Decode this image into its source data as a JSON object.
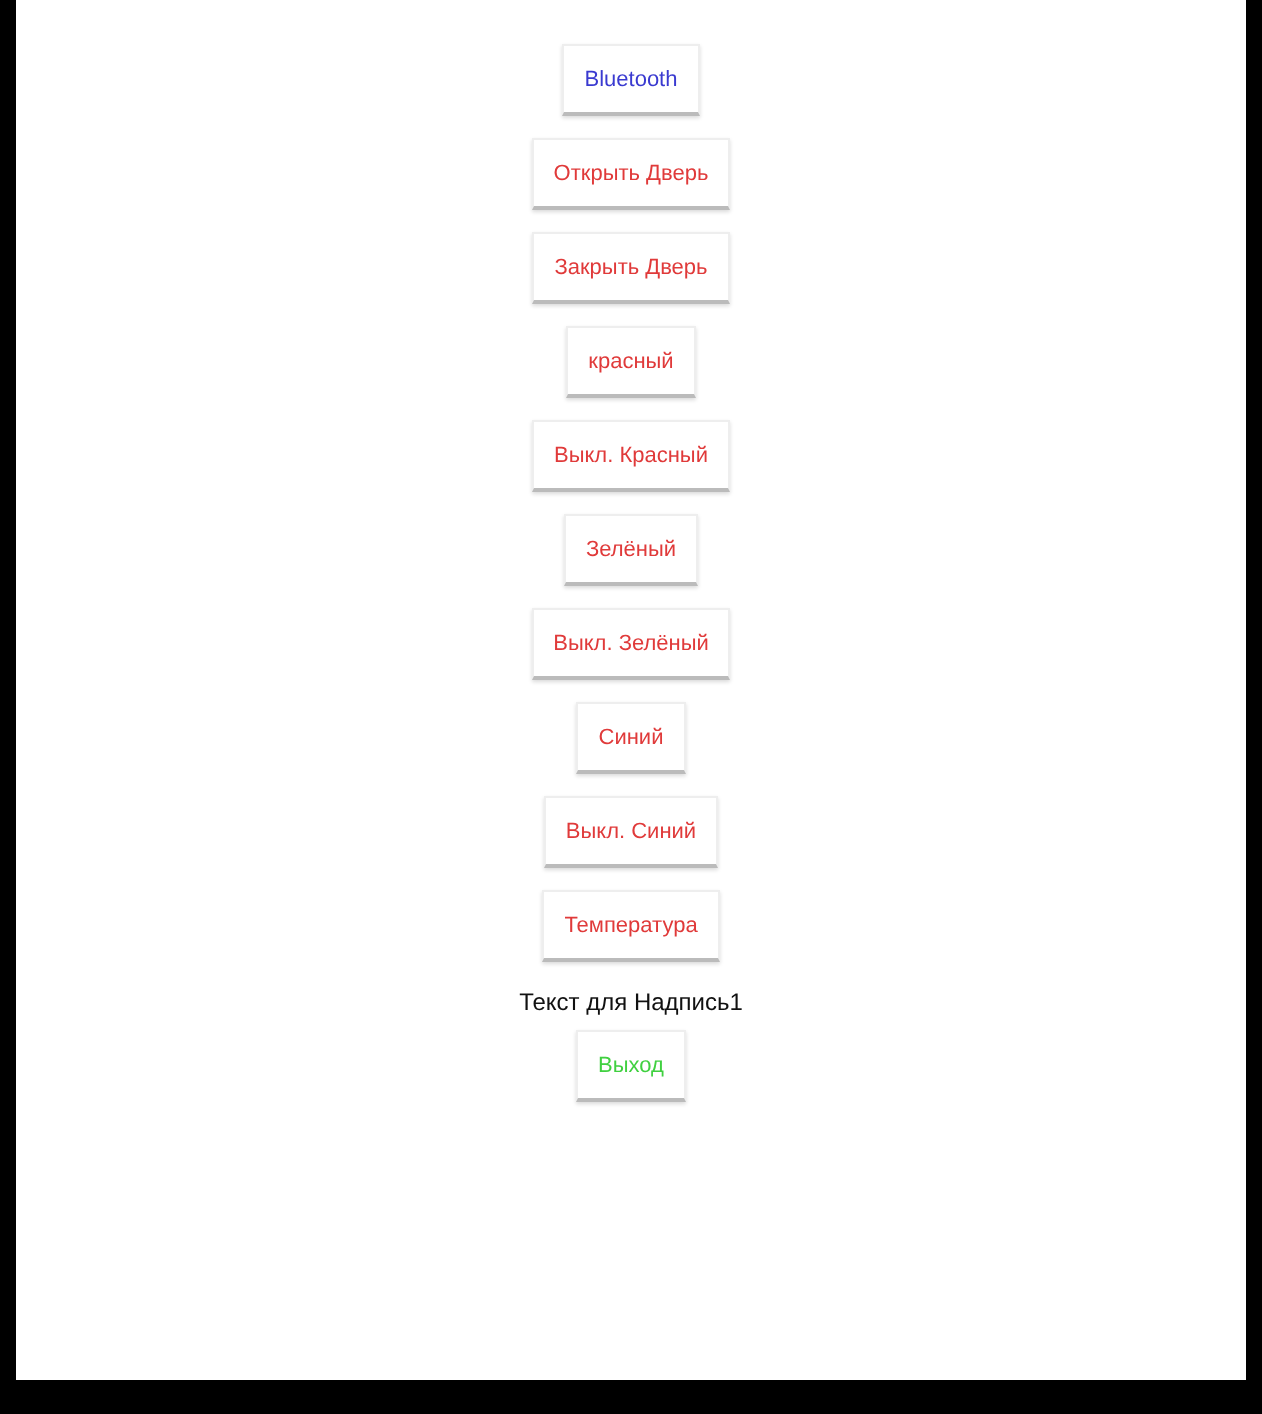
{
  "items": [
    {
      "kind": "button",
      "label": "Bluetooth",
      "color": "#3a3ad0"
    },
    {
      "kind": "button",
      "label": "Открыть Дверь",
      "color": "#e03a3a"
    },
    {
      "kind": "button",
      "label": "Закрыть Дверь",
      "color": "#e03a3a"
    },
    {
      "kind": "button",
      "label": "красный",
      "color": "#e03a3a"
    },
    {
      "kind": "button",
      "label": "Выкл. Красный",
      "color": "#e03a3a"
    },
    {
      "kind": "button",
      "label": "Зелёный",
      "color": "#e03a3a"
    },
    {
      "kind": "button",
      "label": "Выкл. Зелёный",
      "color": "#e03a3a"
    },
    {
      "kind": "button",
      "label": "Синий",
      "color": "#e03a3a"
    },
    {
      "kind": "button",
      "label": "Выкл. Синий",
      "color": "#e03a3a"
    },
    {
      "kind": "button",
      "label": "Температура",
      "color": "#e03a3a"
    },
    {
      "kind": "label",
      "label": "Текст для Надпись1"
    },
    {
      "kind": "button",
      "label": "Выход",
      "color": "#40d040"
    }
  ]
}
